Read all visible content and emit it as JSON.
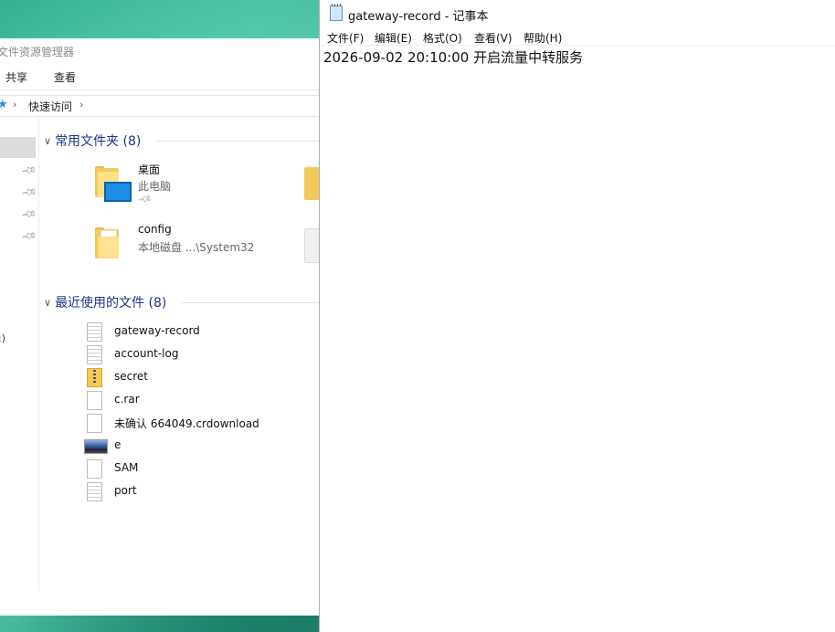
{
  "explorer": {
    "title": "文件资源管理器",
    "ribbon_tabs": [
      "共享",
      "查看"
    ],
    "address": {
      "crumb": "快速访问"
    },
    "nav_partial_label": ":)",
    "quick_access": {
      "header": "常用文件夹 (8)",
      "items": [
        {
          "name": "桌面",
          "location": "此电脑",
          "pinned": true,
          "icon": "desktop-folder-icon"
        },
        {
          "name": "config",
          "location": "本地磁盘 ...\\System32",
          "pinned": false,
          "icon": "folder-icon"
        }
      ]
    },
    "recent": {
      "header": "最近使用的文件 (8)",
      "files": [
        {
          "name": "gateway-record",
          "icon": "text-file-icon"
        },
        {
          "name": "account-log",
          "icon": "text-file-icon"
        },
        {
          "name": "secret",
          "icon": "zip-folder-icon"
        },
        {
          "name": "c.rar",
          "icon": "blank-file-icon"
        },
        {
          "name": "未确认 664049.crdownload",
          "icon": "blank-file-icon"
        },
        {
          "name": "e",
          "icon": "image-file-icon"
        },
        {
          "name": "SAM",
          "icon": "blank-file-icon"
        },
        {
          "name": "port",
          "icon": "text-file-icon"
        }
      ]
    }
  },
  "notepad": {
    "title": "gateway-record - 记事本",
    "menu": [
      "文件(F)",
      "编辑(E)",
      "格式(O)",
      "查看(V)",
      "帮助(H)"
    ],
    "content": "2026-09-02 20:10:00 开启流量中转服务"
  },
  "colors": {
    "section_header": "#1e3287",
    "folder": "#f3c95a",
    "desktop_accent": "#1e8ee6"
  }
}
